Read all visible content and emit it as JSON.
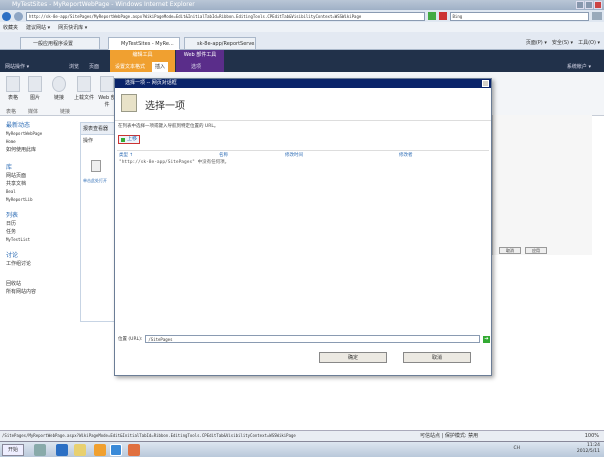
{
  "window": {
    "title": "MyTestSites - MyReportWebPage - Windows Internet Explorer"
  },
  "address": {
    "url": "http://sk-8e-app/SitePages/MyReportWebPage.aspx?WikiPageMode=Edit&InitialTabId=Ribbon.EditingTools.CPEditTab&VisibilityContext=WSSWikiPage",
    "search_placeholder": "Bing"
  },
  "favorites": {
    "label": "收藏夹",
    "items": [
      "建议网站 ▾",
      "网页快讯库 ▾"
    ]
  },
  "tabs": [
    "一般应用程序设置",
    "MyTestSites - MyRe...",
    "sk-8e-app/ReportServe..."
  ],
  "ie_tools": [
    "页面(P) ▾",
    "安全(S) ▾",
    "工具(O) ▾"
  ],
  "ribbon": {
    "site_actions": "网站操作 ▾",
    "tabs": [
      "浏览",
      "页面"
    ],
    "editing_tools": "编辑工具",
    "editing_tabs": [
      "设置文本格式",
      "插入"
    ],
    "webpart_tools": "Web 部件工具",
    "webpart_tabs": [
      "选项"
    ],
    "user": "系统帐户 ▾",
    "buttons": [
      "表格",
      "图片",
      "链接",
      "上载文件",
      "Web 部件"
    ],
    "groups": [
      "表格",
      "媒体",
      "链接"
    ]
  },
  "leftnav": {
    "sections": [
      {
        "title": "最新动态",
        "items": [
          "MyReportWebPage",
          "Home",
          "如何使用此库"
        ]
      },
      {
        "title": "库",
        "items": [
          "网站页面",
          "共享文档",
          "Beal",
          "MyReportLib"
        ]
      },
      {
        "title": "列表",
        "items": [
          "日历",
          "任务",
          "MyTestList"
        ]
      },
      {
        "title": "讨论",
        "items": [
          "工作组讨论"
        ]
      }
    ],
    "bottom": [
      "回收站",
      "所有网站内容"
    ]
  },
  "webpart": {
    "title": "报表查看器",
    "actions": "操作",
    "link": "单击此处打开"
  },
  "background_buttons": [
    "取消",
    "应用"
  ],
  "dialog": {
    "window_title": "选择一项 -- 网页对话框",
    "heading": "选择一项",
    "description": "在列表中选择一项或键入导航到特定位置的 URL。",
    "up_button": "上移",
    "columns": [
      "类型 ↑",
      "名称",
      "修改时间",
      "修改者"
    ],
    "empty_message": "\"http://sk-8e-app/SitePages\" 中没有任何项。",
    "location_label": "位置 (URL):",
    "location_value": "/SitePages",
    "ok": "确定",
    "cancel": "取消"
  },
  "statusbar": {
    "url": "/SitePages/MyReportWebPage.aspx?WikiPageMode=Edit&InitialTabId=Ribbon.EditingTools.CPEditTab&VisibilityContext=WSSWikiPage",
    "zone": "可信站点 | 保护模式: 禁用",
    "zoom": "100%"
  },
  "taskbar": {
    "start": "开始",
    "lang": "CH",
    "time": "11:24",
    "date": "2012/5/11"
  }
}
